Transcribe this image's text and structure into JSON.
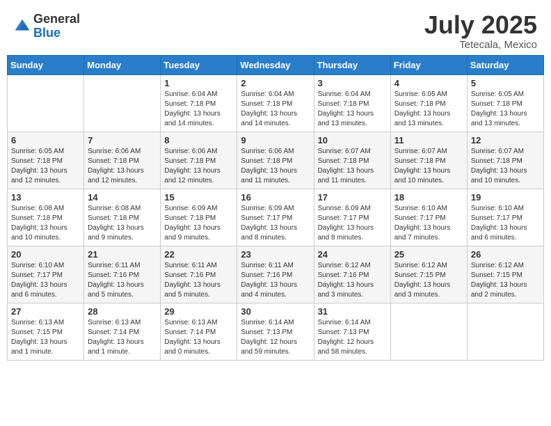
{
  "logo": {
    "general": "General",
    "blue": "Blue"
  },
  "title": "July 2025",
  "location": "Tetecala, Mexico",
  "days_header": [
    "Sunday",
    "Monday",
    "Tuesday",
    "Wednesday",
    "Thursday",
    "Friday",
    "Saturday"
  ],
  "weeks": [
    [
      {
        "day": "",
        "info": ""
      },
      {
        "day": "",
        "info": ""
      },
      {
        "day": "1",
        "info": "Sunrise: 6:04 AM\nSunset: 7:18 PM\nDaylight: 13 hours\nand 14 minutes."
      },
      {
        "day": "2",
        "info": "Sunrise: 6:04 AM\nSunset: 7:18 PM\nDaylight: 13 hours\nand 14 minutes."
      },
      {
        "day": "3",
        "info": "Sunrise: 6:04 AM\nSunset: 7:18 PM\nDaylight: 13 hours\nand 13 minutes."
      },
      {
        "day": "4",
        "info": "Sunrise: 6:05 AM\nSunset: 7:18 PM\nDaylight: 13 hours\nand 13 minutes."
      },
      {
        "day": "5",
        "info": "Sunrise: 6:05 AM\nSunset: 7:18 PM\nDaylight: 13 hours\nand 13 minutes."
      }
    ],
    [
      {
        "day": "6",
        "info": "Sunrise: 6:05 AM\nSunset: 7:18 PM\nDaylight: 13 hours\nand 12 minutes."
      },
      {
        "day": "7",
        "info": "Sunrise: 6:06 AM\nSunset: 7:18 PM\nDaylight: 13 hours\nand 12 minutes."
      },
      {
        "day": "8",
        "info": "Sunrise: 6:06 AM\nSunset: 7:18 PM\nDaylight: 13 hours\nand 12 minutes."
      },
      {
        "day": "9",
        "info": "Sunrise: 6:06 AM\nSunset: 7:18 PM\nDaylight: 13 hours\nand 11 minutes."
      },
      {
        "day": "10",
        "info": "Sunrise: 6:07 AM\nSunset: 7:18 PM\nDaylight: 13 hours\nand 11 minutes."
      },
      {
        "day": "11",
        "info": "Sunrise: 6:07 AM\nSunset: 7:18 PM\nDaylight: 13 hours\nand 10 minutes."
      },
      {
        "day": "12",
        "info": "Sunrise: 6:07 AM\nSunset: 7:18 PM\nDaylight: 13 hours\nand 10 minutes."
      }
    ],
    [
      {
        "day": "13",
        "info": "Sunrise: 6:08 AM\nSunset: 7:18 PM\nDaylight: 13 hours\nand 10 minutes."
      },
      {
        "day": "14",
        "info": "Sunrise: 6:08 AM\nSunset: 7:18 PM\nDaylight: 13 hours\nand 9 minutes."
      },
      {
        "day": "15",
        "info": "Sunrise: 6:09 AM\nSunset: 7:18 PM\nDaylight: 13 hours\nand 9 minutes."
      },
      {
        "day": "16",
        "info": "Sunrise: 6:09 AM\nSunset: 7:17 PM\nDaylight: 13 hours\nand 8 minutes."
      },
      {
        "day": "17",
        "info": "Sunrise: 6:09 AM\nSunset: 7:17 PM\nDaylight: 13 hours\nand 8 minutes."
      },
      {
        "day": "18",
        "info": "Sunrise: 6:10 AM\nSunset: 7:17 PM\nDaylight: 13 hours\nand 7 minutes."
      },
      {
        "day": "19",
        "info": "Sunrise: 6:10 AM\nSunset: 7:17 PM\nDaylight: 13 hours\nand 6 minutes."
      }
    ],
    [
      {
        "day": "20",
        "info": "Sunrise: 6:10 AM\nSunset: 7:17 PM\nDaylight: 13 hours\nand 6 minutes."
      },
      {
        "day": "21",
        "info": "Sunrise: 6:11 AM\nSunset: 7:16 PM\nDaylight: 13 hours\nand 5 minutes."
      },
      {
        "day": "22",
        "info": "Sunrise: 6:11 AM\nSunset: 7:16 PM\nDaylight: 13 hours\nand 5 minutes."
      },
      {
        "day": "23",
        "info": "Sunrise: 6:11 AM\nSunset: 7:16 PM\nDaylight: 13 hours\nand 4 minutes."
      },
      {
        "day": "24",
        "info": "Sunrise: 6:12 AM\nSunset: 7:16 PM\nDaylight: 13 hours\nand 3 minutes."
      },
      {
        "day": "25",
        "info": "Sunrise: 6:12 AM\nSunset: 7:15 PM\nDaylight: 13 hours\nand 3 minutes."
      },
      {
        "day": "26",
        "info": "Sunrise: 6:12 AM\nSunset: 7:15 PM\nDaylight: 13 hours\nand 2 minutes."
      }
    ],
    [
      {
        "day": "27",
        "info": "Sunrise: 6:13 AM\nSunset: 7:15 PM\nDaylight: 13 hours\nand 1 minute."
      },
      {
        "day": "28",
        "info": "Sunrise: 6:13 AM\nSunset: 7:14 PM\nDaylight: 13 hours\nand 1 minute."
      },
      {
        "day": "29",
        "info": "Sunrise: 6:13 AM\nSunset: 7:14 PM\nDaylight: 13 hours\nand 0 minutes."
      },
      {
        "day": "30",
        "info": "Sunrise: 6:14 AM\nSunset: 7:13 PM\nDaylight: 12 hours\nand 59 minutes."
      },
      {
        "day": "31",
        "info": "Sunrise: 6:14 AM\nSunset: 7:13 PM\nDaylight: 12 hours\nand 58 minutes."
      },
      {
        "day": "",
        "info": ""
      },
      {
        "day": "",
        "info": ""
      }
    ]
  ]
}
